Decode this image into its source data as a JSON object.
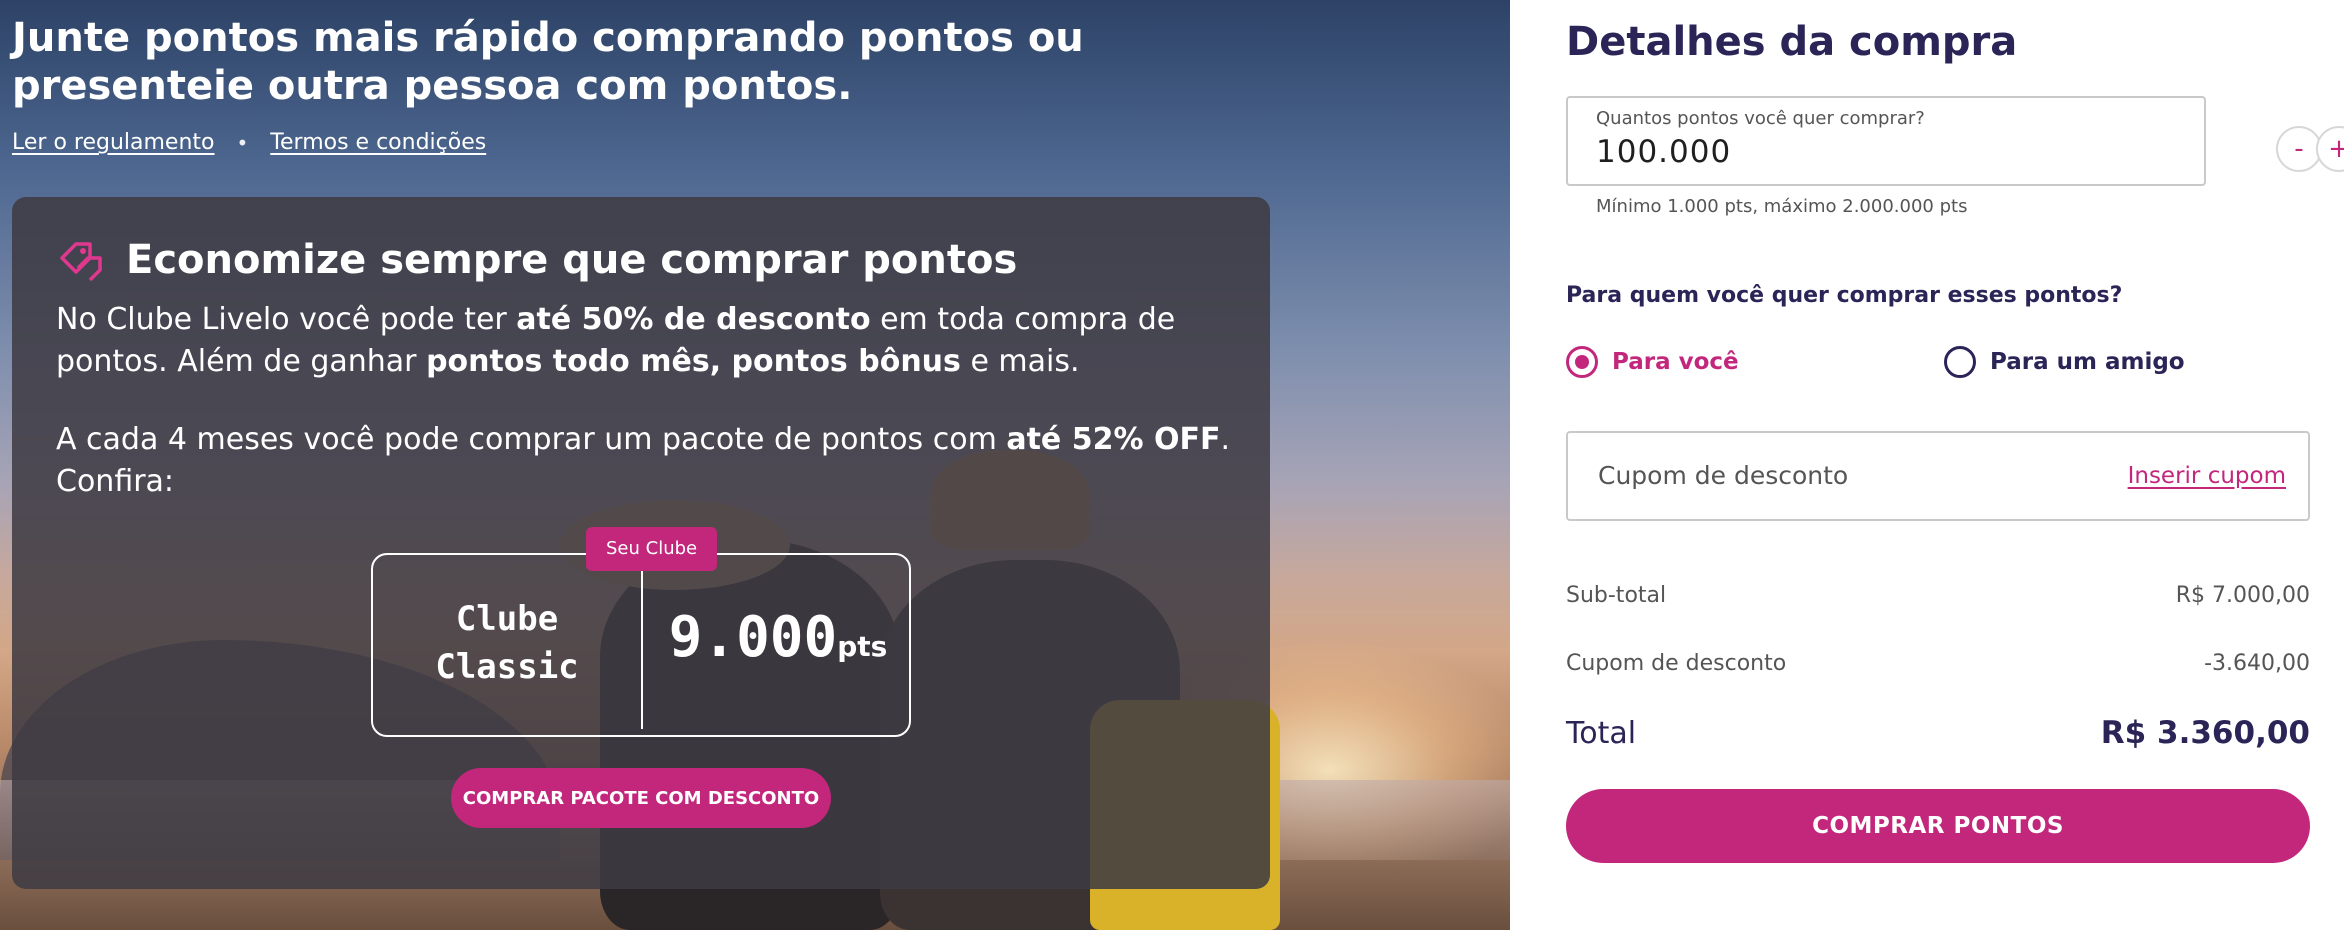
{
  "hero": {
    "title": "Junte pontos mais rápido comprando pontos ou presenteie outra pessoa com pontos.",
    "links": {
      "rules": "Ler o regulamento",
      "separator": "•",
      "terms": "Termos e condições"
    }
  },
  "promo": {
    "icon": "tag-icon",
    "heading": "Economize sempre que comprar pontos",
    "para1": {
      "t1": "No Clube Livelo você pode ter ",
      "b1": "até 50% de desconto",
      "t2": " em toda compra de pontos. Além de ganhar ",
      "b2": "pontos todo mês, pontos bônus",
      "t3": " e mais."
    },
    "para2": {
      "t1": "A cada 4 meses você pode comprar um pacote de pontos com ",
      "b1": "até 52% OFF",
      "t2": ". Confira:"
    },
    "club": {
      "badge": "Seu Clube",
      "name_line1": "Clube",
      "name_line2": "Classic",
      "points": "9.000",
      "unit": "pts"
    },
    "button": "COMPRAR PACOTE COM DESCONTO"
  },
  "panel": {
    "title": "Detalhes da compra",
    "quantity": {
      "label": "Quantos pontos você quer comprar?",
      "value": "100.000",
      "minus": "-",
      "plus": "+",
      "help": "Mínimo 1.000 pts, máximo 2.000.000 pts"
    },
    "recipient": {
      "question": "Para quem você quer comprar esses pontos?",
      "options": [
        {
          "label": "Para você",
          "selected": true
        },
        {
          "label": "Para um amigo",
          "selected": false
        }
      ]
    },
    "coupon": {
      "placeholder": "Cupom de desconto",
      "link": "Inserir cupom"
    },
    "summary": {
      "subtotal_label": "Sub-total",
      "subtotal_value": "R$ 7.000,00",
      "discount_label": "Cupom de desconto",
      "discount_value": "-3.640,00",
      "total_label": "Total",
      "total_value": "R$ 3.360,00"
    },
    "buy_button": "COMPRAR PONTOS"
  },
  "colors": {
    "brand_pink": "#c2277c",
    "navy": "#2a2457"
  }
}
